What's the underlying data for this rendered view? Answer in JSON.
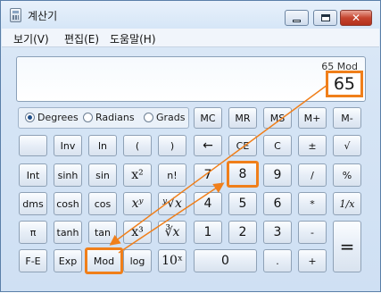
{
  "window": {
    "title": "계산기",
    "icon": "calculator-icon"
  },
  "menu": [
    "보기(V)",
    "편집(E)",
    "도움말(H)"
  ],
  "display": {
    "expression": "65 Mod",
    "value": "65"
  },
  "angle_units": {
    "options": [
      "Degrees",
      "Radians",
      "Grads"
    ],
    "selected": "Degrees"
  },
  "buttons": {
    "MC": "MC",
    "MR": "MR",
    "MS": "MS",
    "Mplus": "M+",
    "Mminus": "M-",
    "Inv": "Inv",
    "ln": "ln",
    "lparen": "(",
    "rparen": ")",
    "back": "←",
    "CE": "CE",
    "C": "C",
    "pm": "±",
    "sqrt": "√",
    "Int": "Int",
    "sinh": "sinh",
    "sin": "sin",
    "x2": "x²",
    "fact": "n!",
    "n7": "7",
    "n8": "8",
    "n9": "9",
    "div": "/",
    "pct": "%",
    "dms": "dms",
    "cosh": "cosh",
    "cos": "cos",
    "xy": "xʸ",
    "yroot": "ʸ√x",
    "n4": "4",
    "n5": "5",
    "n6": "6",
    "mul": "*",
    "recip": "1/x",
    "pi": "π",
    "tanh": "tanh",
    "tan": "tan",
    "x3": "x³",
    "cbrt": "∛x",
    "n1": "1",
    "n2": "2",
    "n3": "3",
    "sub": "-",
    "eq": "=",
    "FE": "F-E",
    "Exp": "Exp",
    "Mod": "Mod",
    "log": "log",
    "tenx": "10ˣ",
    "n0": "0",
    "dot": ".",
    "add": "+"
  },
  "annotation_color": "#f07f1a"
}
